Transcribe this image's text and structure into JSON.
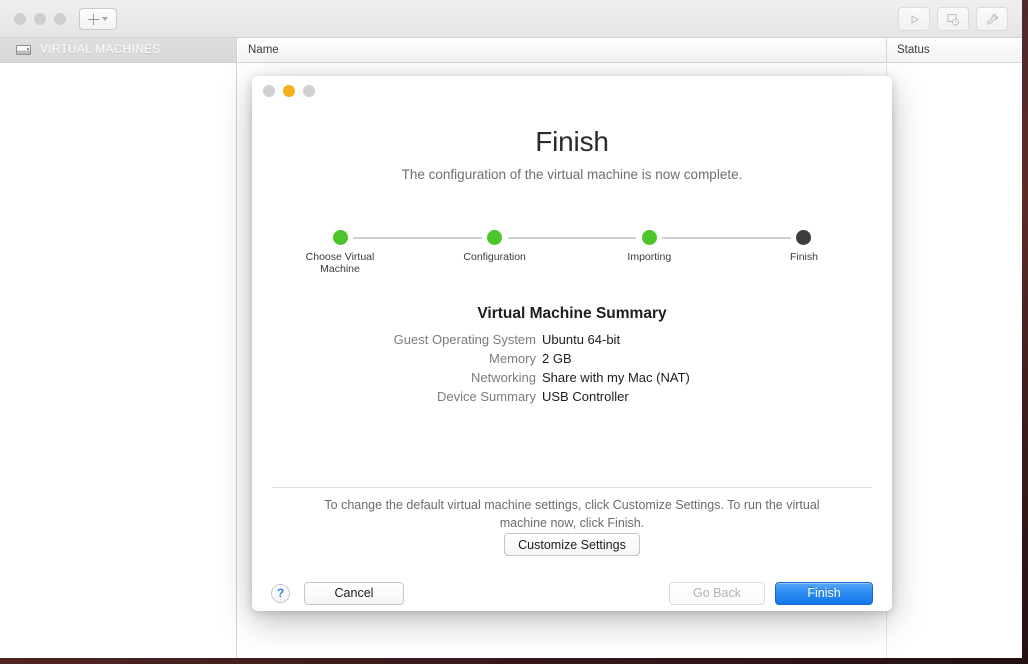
{
  "app": {
    "toolbar": {
      "add_label": "+",
      "add_icon": "plus-icon",
      "add_chevron_icon": "chevron-down-icon",
      "buttons": [
        {
          "name": "play-button",
          "icon": "play-icon"
        },
        {
          "name": "snapshot-button",
          "icon": "snapshot-icon"
        },
        {
          "name": "settings-button",
          "icon": "wrench-icon"
        }
      ]
    },
    "sidebar": {
      "header_title": "VIRTUAL MACHINES",
      "header_icon": "virtual-machine-icon"
    },
    "list": {
      "columns": [
        {
          "key": "name",
          "label": "Name"
        },
        {
          "key": "status",
          "label": "Status"
        }
      ],
      "rows": []
    }
  },
  "dialog": {
    "window_controls": {
      "close": "close-button",
      "minimize": "minimize-button",
      "zoom": "zoom-button"
    },
    "title": "Finish",
    "subtitle": "The configuration of the virtual machine is now complete.",
    "stepper": {
      "steps": [
        {
          "label": "Choose Virtual\nMachine",
          "state": "done"
        },
        {
          "label": "Configuration",
          "state": "done"
        },
        {
          "label": "Importing",
          "state": "done"
        },
        {
          "label": "Finish",
          "state": "current"
        }
      ],
      "colors": {
        "done": "#4cc42c",
        "current": "#3d3d3f",
        "track": "#d0cfd0"
      }
    },
    "summary": {
      "heading": "Virtual Machine Summary",
      "rows": [
        {
          "label": "Guest Operating System",
          "value": "Ubuntu 64-bit"
        },
        {
          "label": "Memory",
          "value": "2 GB"
        },
        {
          "label": "Networking",
          "value": "Share with my Mac (NAT)"
        },
        {
          "label": "Device Summary",
          "value": "USB Controller"
        }
      ]
    },
    "footer": {
      "note": "To change the default virtual machine settings, click Customize Settings. To run the virtual machine now, click Finish.",
      "customize_label": "Customize Settings",
      "help_label": "?",
      "cancel_label": "Cancel",
      "go_back_label": "Go Back",
      "finish_label": "Finish",
      "finish_accent_color": "#1477e8"
    }
  }
}
